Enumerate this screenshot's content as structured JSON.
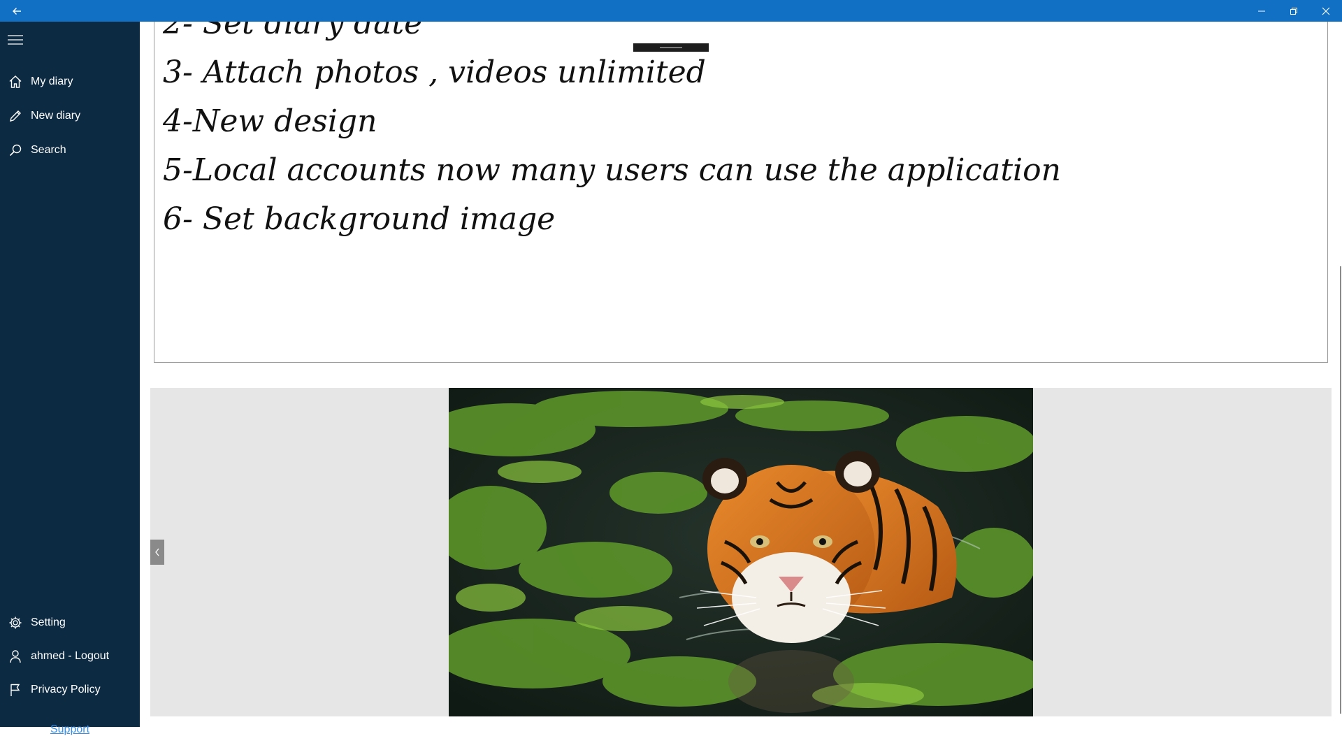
{
  "titlebar": {
    "back_icon": "back-arrow-icon",
    "minimize_icon": "minimize-icon",
    "restore_icon": "restore-icon",
    "close_icon": "close-icon",
    "accent": "#1170c4"
  },
  "sidebar": {
    "background": "#0d2a43",
    "menu_icon": "hamburger-icon",
    "top_items": [
      {
        "label": "My diary",
        "icon": "home-icon"
      },
      {
        "label": "New diary",
        "icon": "pencil-icon"
      },
      {
        "label": "Search",
        "icon": "search-icon"
      }
    ],
    "bottom_items": [
      {
        "label": "Setting",
        "icon": "gear-icon"
      },
      {
        "label": "ahmed - Logout",
        "icon": "person-icon"
      },
      {
        "label": "Privacy Policy",
        "icon": "flag-icon"
      }
    ],
    "support_label": "Support"
  },
  "editor": {
    "lines": [
      "2- Set diary date",
      "3- Attach photos , videos unlimited",
      "4-New design",
      "5-Local accounts now many users can use the application",
      "6- Set background image"
    ]
  },
  "gallery": {
    "prev_icon": "chevron-left-icon",
    "photo_subject": "tiger-swimming-photo"
  }
}
